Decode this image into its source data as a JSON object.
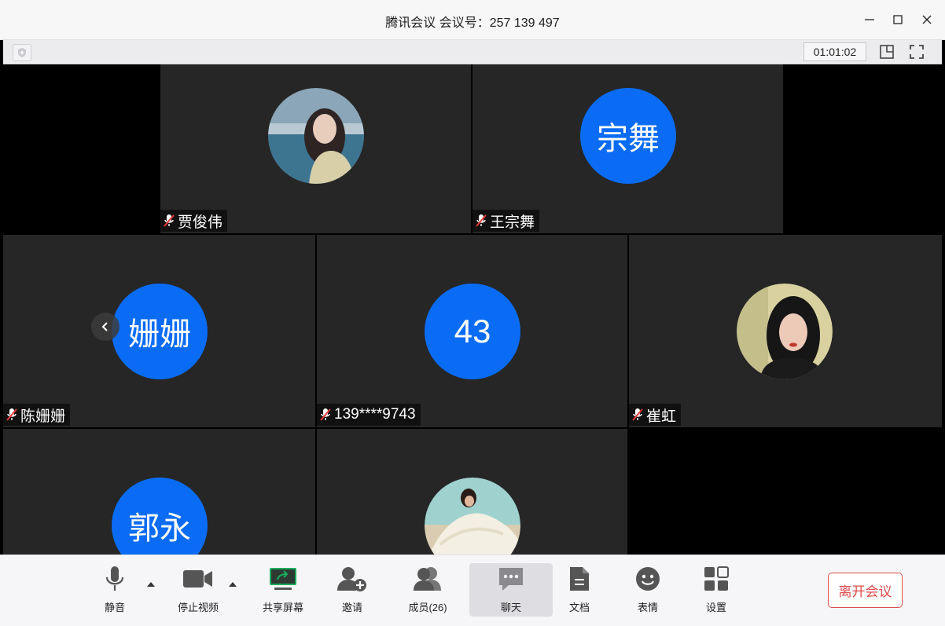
{
  "window": {
    "title": "腾讯会议 会议号：257 139 497"
  },
  "infobar": {
    "timer": "01:01:02"
  },
  "participants": [
    {
      "name": "贾俊伟",
      "avatar_type": "photo"
    },
    {
      "name": "王宗舞",
      "avatar_text": "宗舞"
    },
    {
      "name": "陈姗姗",
      "avatar_text": "姗姗"
    },
    {
      "name": "139****9743",
      "avatar_text": "43"
    },
    {
      "name": "崔虹",
      "avatar_type": "photo"
    },
    {
      "name": "",
      "avatar_text": "郭永"
    },
    {
      "name": "",
      "avatar_type": "photo"
    }
  ],
  "toolbar": {
    "mute": "静音",
    "stop_video": "停止视频",
    "share_screen": "共享屏幕",
    "invite": "邀请",
    "members": "成员(26)",
    "chat": "聊天",
    "docs": "文档",
    "emoji": "表情",
    "settings": "设置",
    "leave": "离开会议"
  },
  "colors": {
    "avatar_blue": "#0a6cf5",
    "tile_bg": "#262626",
    "leave_red": "#e04a4a",
    "share_green": "#1aad5d",
    "muted_red": "#e53935"
  }
}
